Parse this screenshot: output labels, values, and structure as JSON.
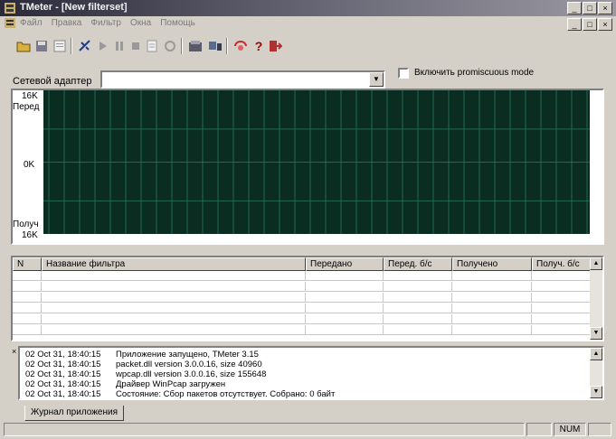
{
  "window": {
    "title": "TMeter - [New filterset]",
    "controls": [
      "_",
      "□",
      "×"
    ]
  },
  "menu": {
    "items": [
      "Файл",
      "Правка",
      "Фильтр",
      "Окна",
      "Помощь"
    ]
  },
  "toolbar": {
    "icons": [
      "open-icon",
      "save-icon",
      "properties-icon",
      "connect-icon",
      "play-icon",
      "pause-icon",
      "stop-icon",
      "print-icon",
      "refresh-icon",
      "settings-icon",
      "network-icon",
      "monitor-icon",
      "help-icon",
      "exit-icon"
    ]
  },
  "adapter": {
    "label": "Сетевой адаптер",
    "value": "",
    "promiscuous_label": "Включить promiscuous mode",
    "promiscuous_checked": false
  },
  "graph": {
    "top_value": "16K",
    "top_label": "Перед",
    "mid_value": "0K",
    "bottom_label": "Получ",
    "bottom_value": "16K",
    "background": "#0b2d21",
    "grid_color": "#1f6a50"
  },
  "table": {
    "columns": [
      "N",
      "Название фильтра",
      "Передано",
      "Перед. б/с",
      "Получено",
      "Получ. б/с"
    ],
    "rows": []
  },
  "log": {
    "entries": [
      {
        "time": "02 Oct 31, 18:40:15",
        "message": "Приложение запущено, TMeter 3.15"
      },
      {
        "time": "02 Oct 31, 18:40:15",
        "message": "packet.dll version 3.0.0.16, size 40960"
      },
      {
        "time": "02 Oct 31, 18:40:15",
        "message": "wpcap.dll version 3.0.0.16, size 155648"
      },
      {
        "time": "02 Oct 31, 18:40:15",
        "message": "Драйвер WinPcap загружен"
      },
      {
        "time": "02 Oct 31, 18:40:15",
        "message": "Состояние: Сбор пакетов отсутствует. Собрано: 0 байт"
      }
    ],
    "tab_label": "Журнал приложения",
    "close_glyph": "×"
  },
  "status": {
    "num": "NUM"
  }
}
